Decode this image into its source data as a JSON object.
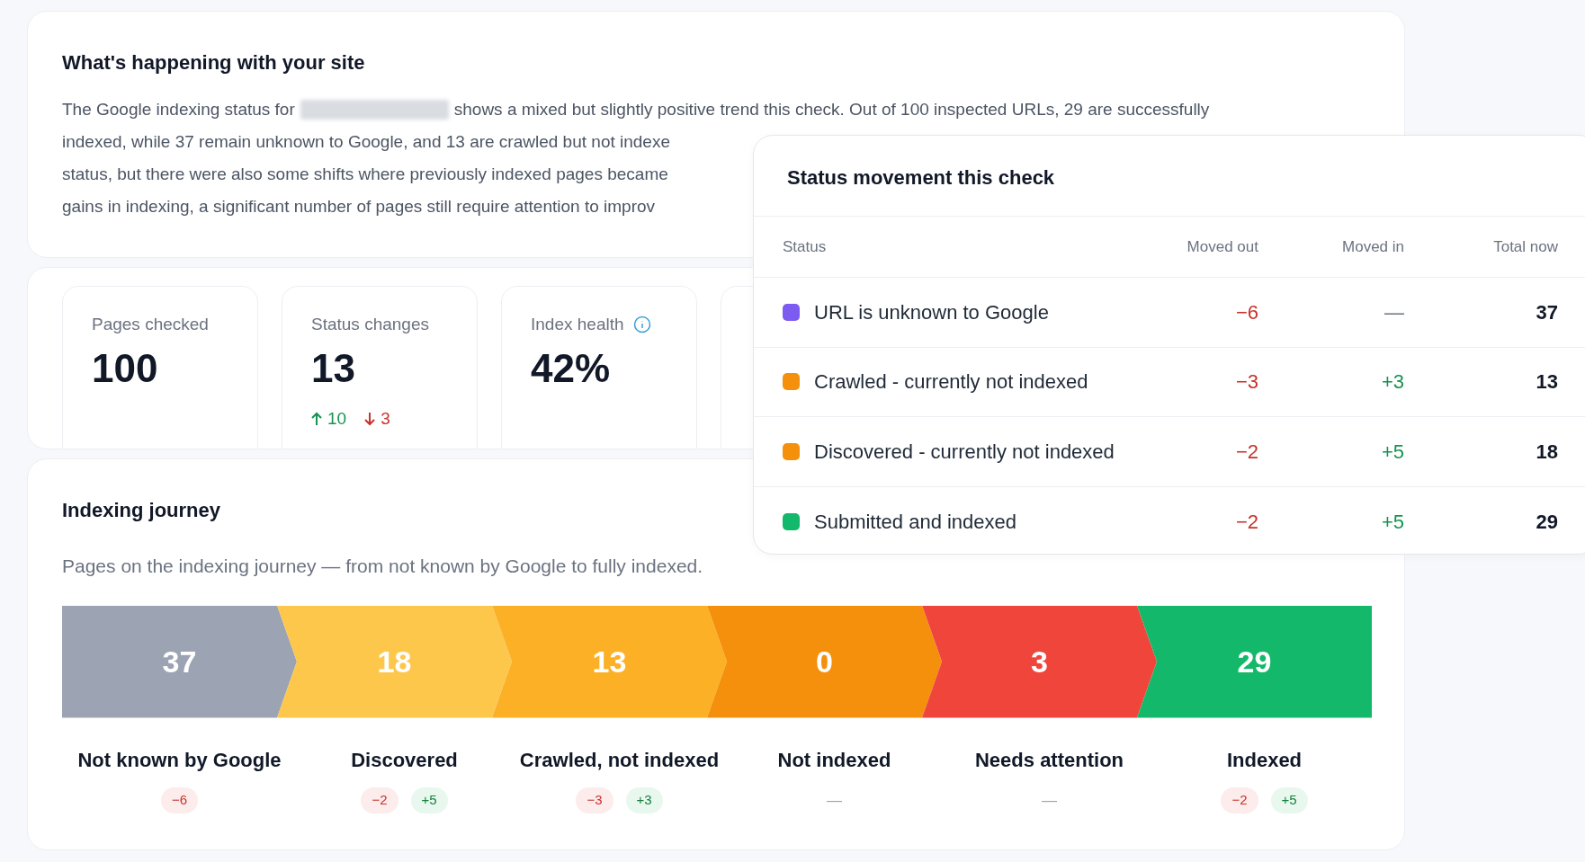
{
  "summary": {
    "title": "What's happening with your site",
    "lines": [
      {
        "before": "The Google indexing status for",
        "redacted": true,
        "after": "shows a mixed but slightly positive trend this check. Out of 100 inspected URLs, 29 are successfully"
      },
      {
        "before": "indexed, while 37 remain unknown to Google, and 13 are crawled but not indexe"
      },
      {
        "before": "status, but there were also some shifts where previously indexed pages became"
      },
      {
        "before": "gains in indexing, a significant number of pages still require attention to improv"
      }
    ]
  },
  "stats": [
    {
      "label": "Pages checked",
      "value": "100"
    },
    {
      "label": "Status changes",
      "value": "13",
      "up": "10",
      "down": "3"
    },
    {
      "label": "Index health",
      "value": "42%",
      "info": true
    }
  ],
  "journey": {
    "title": "Indexing journey",
    "subtitle": "Pages on the indexing journey — from not known by Google to fully indexed.",
    "stages": [
      {
        "count": "37",
        "label": "Not known by Google",
        "color": "#9ca3b3",
        "changes": [
          {
            "kind": "down",
            "text": "−6"
          }
        ]
      },
      {
        "count": "18",
        "label": "Discovered",
        "color": "#fdc74c",
        "changes": [
          {
            "kind": "down",
            "text": "−2"
          },
          {
            "kind": "up",
            "text": "+5"
          }
        ]
      },
      {
        "count": "13",
        "label": "Crawled, not indexed",
        "color": "#fbb026",
        "changes": [
          {
            "kind": "down",
            "text": "−3"
          },
          {
            "kind": "up",
            "text": "+3"
          }
        ]
      },
      {
        "count": "0",
        "label": "Not indexed",
        "color": "#f5900d",
        "none": "—"
      },
      {
        "count": "3",
        "label": "Needs attention",
        "color": "#f0453b",
        "none": "—"
      },
      {
        "count": "29",
        "label": "Indexed",
        "color": "#14b86a",
        "changes": [
          {
            "kind": "down",
            "text": "−2"
          },
          {
            "kind": "up",
            "text": "+5"
          }
        ]
      }
    ]
  },
  "movement": {
    "title": "Status movement this check",
    "columns": [
      "Status",
      "Moved out",
      "Moved in",
      "Total now"
    ],
    "rows": [
      {
        "color": "#7c5cf0",
        "status": "URL is unknown to Google",
        "moved_out": "−6",
        "moved_in": {
          "kind": "none",
          "text": "—"
        },
        "total": "37"
      },
      {
        "color": "#f5900d",
        "status": "Crawled - currently not indexed",
        "moved_out": "−3",
        "moved_in": {
          "kind": "up",
          "text": "+3"
        },
        "total": "13"
      },
      {
        "color": "#f5900d",
        "status": "Discovered - currently not indexed",
        "moved_out": "−2",
        "moved_in": {
          "kind": "up",
          "text": "+5"
        },
        "total": "18"
      },
      {
        "color": "#14b86a",
        "status": "Submitted and indexed",
        "moved_out": "−2",
        "moved_in": {
          "kind": "up",
          "text": "+5"
        },
        "total": "29"
      }
    ]
  }
}
